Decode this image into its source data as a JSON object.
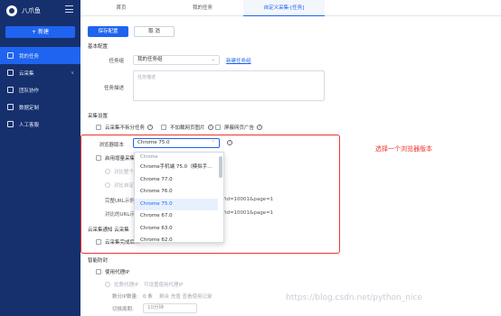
{
  "app": {
    "name": "八爪鱼",
    "new_button": "+ 新建"
  },
  "nav": [
    {
      "label": "我的任务",
      "icon": "task-icon",
      "active": true
    },
    {
      "label": "云采集",
      "icon": "cloud-icon",
      "chevron": "∨"
    },
    {
      "label": "团队协作",
      "icon": "team-icon"
    },
    {
      "label": "数据定制",
      "icon": "data-icon"
    },
    {
      "label": "人工客服",
      "icon": "support-icon"
    }
  ],
  "tabs": [
    "首页",
    "我的任务",
    "自定义采集-[任务]"
  ],
  "toolbar": {
    "save": "保存配置",
    "cancel": "取 消"
  },
  "basic": {
    "section": "基本配置",
    "group_label": "任务组",
    "group_value": "我的任务组",
    "new_group_link": "新建任务组",
    "desc_label": "任务描述",
    "desc_placeholder": "任务描述"
  },
  "collect": {
    "section": "采集设置",
    "options": [
      "云采集不拆分任务",
      "不加载网页图片",
      "屏蔽网页广告"
    ],
    "browser_label": "浏览器版本",
    "browser_value": "Chrome 75.0",
    "incremental": "启用增量采集",
    "inc_opt1": "对比整个...",
    "inc_opt2": "对比自定...",
    "full_url_label": "完整URL示例",
    "full_url_tail": "?id=10001&page=1",
    "compare_url_label": "对比的URL示",
    "compare_url_tail": "?id=10001&page=1"
  },
  "dropdown": {
    "group": "Chrome",
    "options": [
      "Chrome手机端 75.0（模拟手...",
      "Chrome 77.0",
      "Chrome 76.0",
      "Chrome 75.0",
      "Chrome 67.0",
      "Chrome 63.0",
      "Chrome 62.0"
    ],
    "selected": "Chrome 75.0"
  },
  "notify": {
    "section": "云采集通知 云采集",
    "option": "云采集完成后..."
  },
  "anti_block": {
    "section": "智能防封",
    "use_proxy": "使用代理IP",
    "proxy_option": "优质代理IP",
    "proxy_note": "可设置使用代理IP",
    "switch_count_label": "数分IP数量:",
    "switch_count_value": "0 条",
    "switch_extra": "剩余   充值   查看使用记录",
    "switch_interval_label": "切换周期:",
    "switch_interval_value": "10分钟"
  },
  "annotation": "选择一个浏览器版本",
  "watermark": "https://blog.csdn.net/python_nice"
}
